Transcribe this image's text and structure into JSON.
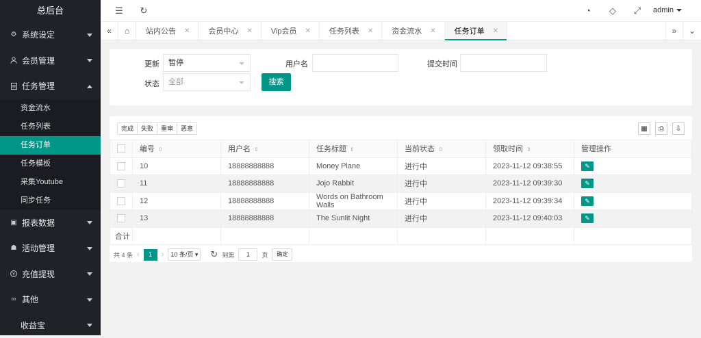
{
  "app_title": "总后台",
  "sidebar": {
    "groups": [
      {
        "label": "系统设定",
        "icon": "gear-icon"
      },
      {
        "label": "会员管理",
        "icon": "user-icon"
      },
      {
        "label": "任务管理",
        "icon": "document-icon"
      },
      {
        "label": "报表数据",
        "icon": "book-icon"
      },
      {
        "label": "活动管理",
        "icon": "group-icon"
      },
      {
        "label": "充值提现",
        "icon": "yen-icon"
      },
      {
        "label": "其他",
        "icon": "link-icon"
      },
      {
        "label": "收益宝",
        "icon": ""
      }
    ],
    "task_sub": [
      "资金流水",
      "任务列表",
      "任务订单",
      "任务模板",
      "采集Youtube",
      "同步任务"
    ],
    "active_sub": "任务订单"
  },
  "topbar": {
    "user": "admin"
  },
  "tabs": [
    {
      "label": "站内公告"
    },
    {
      "label": "会员中心"
    },
    {
      "label": "Vip会员"
    },
    {
      "label": "任务列表"
    },
    {
      "label": "资金流水"
    },
    {
      "label": "任务订单"
    }
  ],
  "filter": {
    "update_label": "更新",
    "update_value": "暂停",
    "status_label": "状态",
    "status_placeholder": "全部",
    "username_label": "用户名",
    "submit_time_label": "提交时间",
    "search_button": "搜索"
  },
  "toolbar": {
    "complete": "完成",
    "fail": "失败",
    "redo": "重审",
    "malicious": "恶意"
  },
  "table": {
    "headers": [
      "编号",
      "用户名",
      "任务标题",
      "当前状态",
      "领取时间",
      "管理操作"
    ],
    "rows": [
      [
        "10",
        "18888888888",
        "Money Plane",
        "进行中",
        "2023-11-12 09:38:55"
      ],
      [
        "11",
        "18888888888",
        "Jojo Rabbit",
        "进行中",
        "2023-11-12 09:39:30"
      ],
      [
        "12",
        "18888888888",
        "Words on Bathroom Walls",
        "进行中",
        "2023-11-12 09:39:34"
      ],
      [
        "13",
        "18888888888",
        "The Sunlit Night",
        "进行中",
        "2023-11-12 09:40:03"
      ]
    ],
    "total_label": "合计"
  },
  "pager": {
    "count": "共 4 条",
    "current": "1",
    "page_size": "10 条/页",
    "goto": "到第",
    "goto_value": "1",
    "page_unit": "页",
    "confirm": "确定"
  },
  "colors": {
    "accent": "#009688",
    "sidebar": "#20222a"
  }
}
